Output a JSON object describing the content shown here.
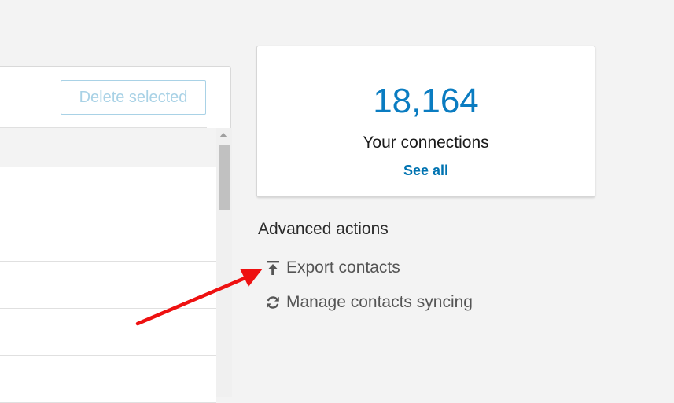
{
  "list_panel": {
    "delete_button_label": "Delete selected"
  },
  "connections_card": {
    "count": "18,164",
    "label": "Your connections",
    "see_all_label": "See all"
  },
  "advanced_actions": {
    "title": "Advanced actions",
    "items": [
      {
        "label": "Export contacts",
        "icon": "export-upload-icon"
      },
      {
        "label": "Manage contacts syncing",
        "icon": "sync-icon"
      }
    ]
  },
  "colors": {
    "accent_blue": "#0a7cc1",
    "link_blue": "#0073b1",
    "disabled_button": "#a9d2e6",
    "annotation_arrow": "#ee1111"
  }
}
